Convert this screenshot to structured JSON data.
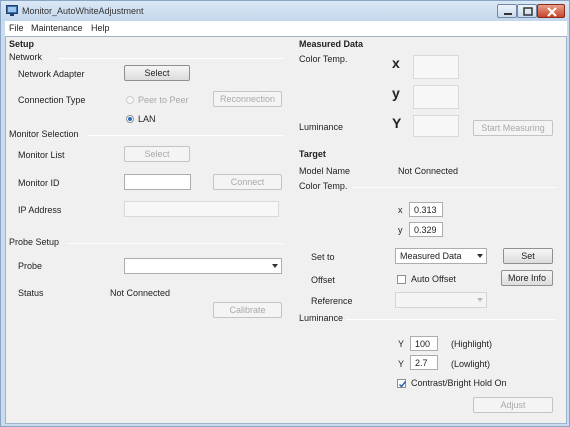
{
  "window": {
    "title": "Monitor_AutoWhiteAdjustment",
    "icon": "monitor-icon",
    "controls": [
      "minimize-icon",
      "maximize-icon",
      "close-icon"
    ]
  },
  "menu": {
    "file": "File",
    "maintenance": "Maintenance",
    "help": "Help"
  },
  "setup": {
    "title": "Setup",
    "network": {
      "group": "Network",
      "adapter_label": "Network Adapter",
      "select_button": "Select",
      "connection_type_label": "Connection Type",
      "peer_option": "Peer to Peer",
      "reconnection_button": "Reconnection",
      "lan_option": "LAN",
      "selected_option": "LAN"
    },
    "monitor_selection": {
      "group": "Monitor Selection",
      "monitor_list_label": "Monitor List",
      "select_button": "Select",
      "monitor_id_label": "Monitor ID",
      "monitor_id_value": "",
      "connect_button": "Connect",
      "ip_address_label": "IP Address",
      "ip_address_value": ""
    },
    "probe_setup": {
      "group": "Probe Setup",
      "probe_label": "Probe",
      "probe_value": "",
      "status_label": "Status",
      "status_value": "Not Connected",
      "calibrate_button": "Calibrate"
    }
  },
  "measured": {
    "title": "Measured Data",
    "color_temp_label": "Color Temp.",
    "x_symbol": "x",
    "y_symbol": "y",
    "x_value": "",
    "y_value": "",
    "luminance_label": "Luminance",
    "Y_symbol": "Y",
    "Y_value": "",
    "start_button": "Start Measuring"
  },
  "target": {
    "title": "Target",
    "model_name_label": "Model Name",
    "model_name_value": "Not Connected",
    "color_temp_group": "Color Temp.",
    "x_label": "x",
    "x_value": "0.313",
    "y_label": "y",
    "y_value": "0.329",
    "set_to_label": "Set to",
    "set_to_value": "Measured Data",
    "set_button": "Set",
    "offset_label": "Offset",
    "auto_offset_label": "Auto Offset",
    "auto_offset_checked": false,
    "more_info_button": "More Info",
    "reference_label": "Reference",
    "reference_value": "",
    "luminance_group": "Luminance",
    "Y_label": "Y",
    "highlight_value": "100",
    "highlight_label": "(Highlight)",
    "lowlight_value": "2.7",
    "lowlight_label": "(Lowlight)",
    "contrast_hold_label": "Contrast/Bright Hold On",
    "contrast_hold_checked": true,
    "adjust_button": "Adjust"
  }
}
